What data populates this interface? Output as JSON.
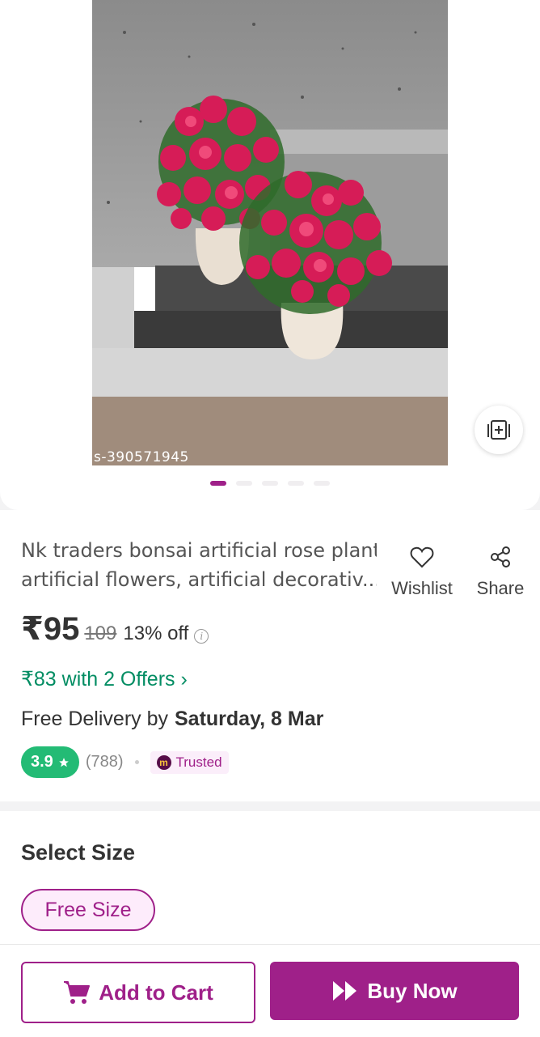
{
  "product": {
    "image_id": "s-390571945",
    "image_dots_count": 5,
    "title_line1": "Nk traders bonsai artificial rose plant",
    "title_line2": "artificial flowers, artificial decorativ...",
    "price": "₹95",
    "mrp": "109",
    "discount": "13% off"
  },
  "actions": {
    "wishlist_label": "Wishlist",
    "share_label": "Share"
  },
  "offer": {
    "text": "₹83 with 2 Offers ›"
  },
  "delivery": {
    "prefix": "Free Delivery by",
    "date": "Saturday, 8 Mar"
  },
  "rating": {
    "value": "3.9",
    "count": "(788)",
    "trusted_label": "Trusted",
    "badge_color": "#23bb75"
  },
  "size": {
    "heading": "Select Size",
    "selected": "Free Size"
  },
  "bottom": {
    "add_to_cart_label": "Add to Cart",
    "buy_now_label": "Buy Now"
  },
  "colors": {
    "accent": "#9f2089",
    "offer_green": "#038d63"
  },
  "icons": [
    "add-collection-icon",
    "heart-icon",
    "share-icon",
    "info-icon",
    "star-icon",
    "meesho-logo-icon",
    "cart-icon",
    "fast-forward-icon"
  ]
}
